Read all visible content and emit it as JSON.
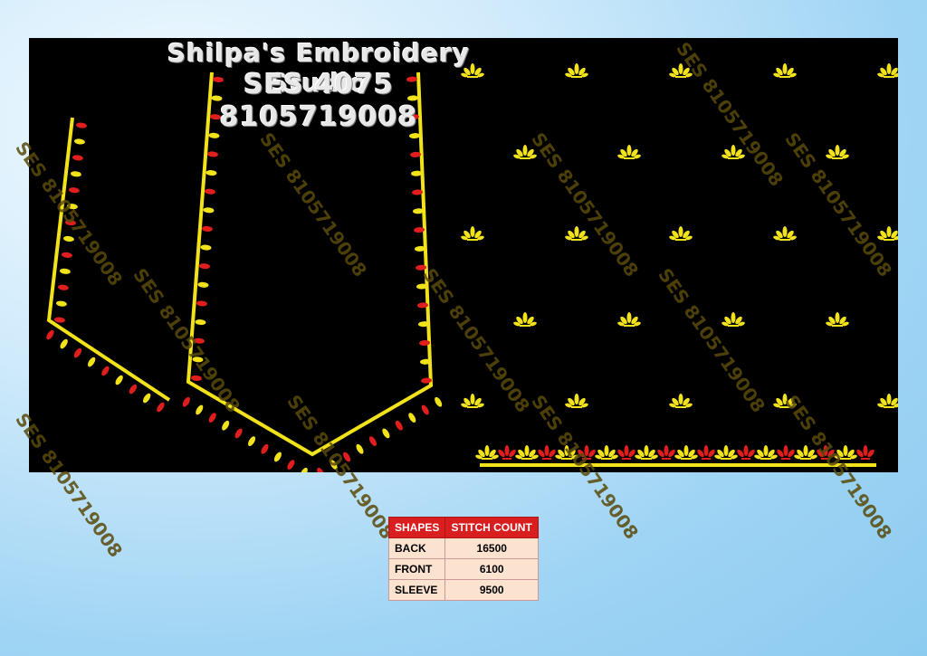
{
  "header": {
    "studio_name": "Shilpa's Embroidery Studio",
    "design_code": "SES 4075",
    "phone": "8105719008"
  },
  "watermark": "SES 8105719008",
  "colors": {
    "background": "#000000",
    "outline": "#f2e21a",
    "motif_yellow": "#f2e21a",
    "motif_red": "#e01e1e",
    "table_header": "#d81e1e",
    "table_cell": "#fbe3d0"
  },
  "stitch_table": {
    "headers": [
      "SHAPES",
      "STITCH COUNT"
    ],
    "rows": [
      {
        "shape": "BACK",
        "count": "16500"
      },
      {
        "shape": "FRONT",
        "count": "6100"
      },
      {
        "shape": "SLEEVE",
        "count": "9500"
      }
    ]
  }
}
